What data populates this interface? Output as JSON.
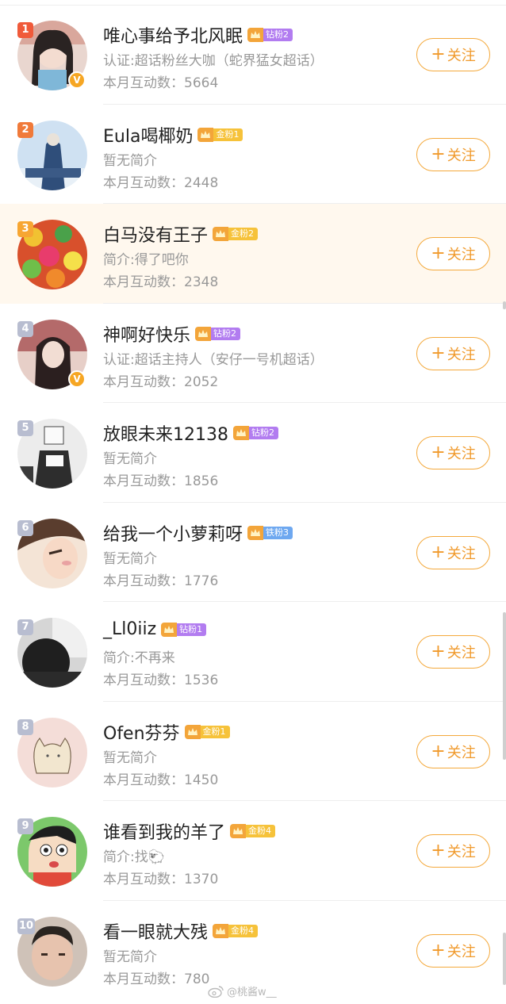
{
  "follow_label": "关注",
  "users": [
    {
      "rank": "1",
      "name": "唯心事给予北风眠",
      "fan_label": "钻粉2",
      "fan_type": "diamond",
      "desc": "认证:超话粉丝大咖（蛇界猛女超话）",
      "count": "本月互动数：5664",
      "verified": true,
      "rank_color": "#f05a3a",
      "avatar": "girl-photo"
    },
    {
      "rank": "2",
      "name": "Eula喝椰奶",
      "fan_label": "金粉1",
      "fan_type": "gold",
      "desc": "暂无简介",
      "count": "本月互动数：2448",
      "verified": false,
      "rank_color": "#f07a3a",
      "avatar": "sky-figure"
    },
    {
      "rank": "3",
      "name": "白马没有王子",
      "fan_label": "金粉2",
      "fan_type": "gold",
      "desc": "简介:得了吧你",
      "count": "本月互动数：2348",
      "verified": false,
      "rank_color": "#f7a632",
      "avatar": "candy-pile"
    },
    {
      "rank": "4",
      "name": "神啊好快乐",
      "fan_label": "钻粉2",
      "fan_type": "diamond",
      "desc": "认证:超话主持人（安仔一号机超话）",
      "count": "本月互动数：2052",
      "verified": true,
      "rank_color": "#b8bdd0",
      "avatar": "girl-dark-hair"
    },
    {
      "rank": "5",
      "name": "放眼未来12138",
      "fan_label": "钻粉2",
      "fan_type": "diamond",
      "desc": "暂无简介",
      "count": "本月互动数：1856",
      "verified": false,
      "rank_color": "#b8bdd0",
      "avatar": "box-head-figure"
    },
    {
      "rank": "6",
      "name": "给我一个小萝莉呀",
      "fan_label": "铁粉3",
      "fan_type": "iron",
      "desc": "暂无简介",
      "count": "本月互动数：1776",
      "verified": false,
      "rank_color": "#b8bdd0",
      "avatar": "anime-face"
    },
    {
      "rank": "7",
      "name": "_Ll0iiz",
      "fan_label": "钻粉1",
      "fan_type": "diamond",
      "desc": "简介:不再来",
      "count": "本月互动数：1536",
      "verified": false,
      "rank_color": "#b8bdd0",
      "avatar": "dark-photo"
    },
    {
      "rank": "8",
      "name": "Ofen芬芬",
      "fan_label": "金粉1",
      "fan_type": "gold-plain",
      "desc": "暂无简介",
      "count": "本月互动数：1450",
      "verified": false,
      "rank_color": "#b8bdd0",
      "avatar": "cat-doodle"
    },
    {
      "rank": "9",
      "name": "谁看到我的羊了",
      "fan_label": "金粉4",
      "fan_type": "gold",
      "desc": "简介:找🐑",
      "count": "本月互动数：1370",
      "verified": false,
      "rank_color": "#b8bdd0",
      "avatar": "cartoon-boy"
    },
    {
      "rank": "10",
      "name": "看一眼就大残",
      "fan_label": "金粉4",
      "fan_type": "gold-plain",
      "desc": "暂无简介",
      "count": "本月互动数：780",
      "verified": false,
      "rank_color": "#b8bdd0",
      "avatar": "face-photo"
    }
  ],
  "watermark": "@桃酱w__",
  "colors": {
    "diamond": "#b27cf0",
    "gold": "#f6c23a",
    "iron": "#6ea8f0",
    "follow": "#f09a2c",
    "highlight_bg": "#fff8ee"
  }
}
